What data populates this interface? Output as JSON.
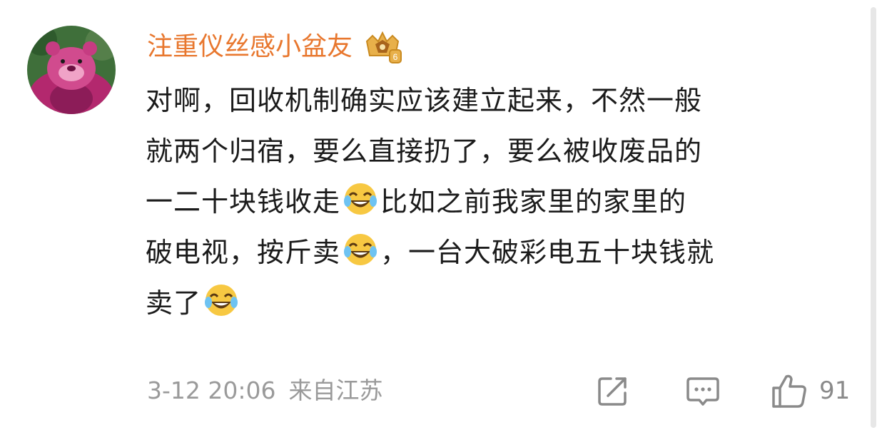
{
  "post": {
    "username": "注重仪丝感小盆友",
    "comment_lines": [
      {
        "text_before": "对啊，回收机制确实应该建立起来，不然一般",
        "emoji": false,
        "text_after": ""
      },
      {
        "text_before": "就两个归宿，要么直接扔了，要么被收废品的",
        "emoji": false,
        "text_after": ""
      },
      {
        "text_before": "一二十块钱收走",
        "emoji": true,
        "text_after": "比如之前我家里的家里的"
      },
      {
        "text_before": "破电视，按斤卖",
        "emoji": true,
        "text_after": "，一台大破彩电五十块钱就"
      },
      {
        "text_before": "卖了",
        "emoji": true,
        "text_after": ""
      }
    ],
    "timestamp": "3-12 20:06",
    "location": "来自江苏",
    "like_count": "91"
  },
  "icons": {
    "avatar": "lotso-bear-avatar",
    "badge": "vip-crown-badge",
    "emoji": "laugh-cry-emoji",
    "share": "share-icon",
    "comment": "comment-icon",
    "like": "thumbs-up-icon"
  },
  "colors": {
    "username": "#e8772e",
    "text": "#1b1b1b",
    "meta": "#9a9a9a",
    "icon": "#8a8a8a"
  }
}
